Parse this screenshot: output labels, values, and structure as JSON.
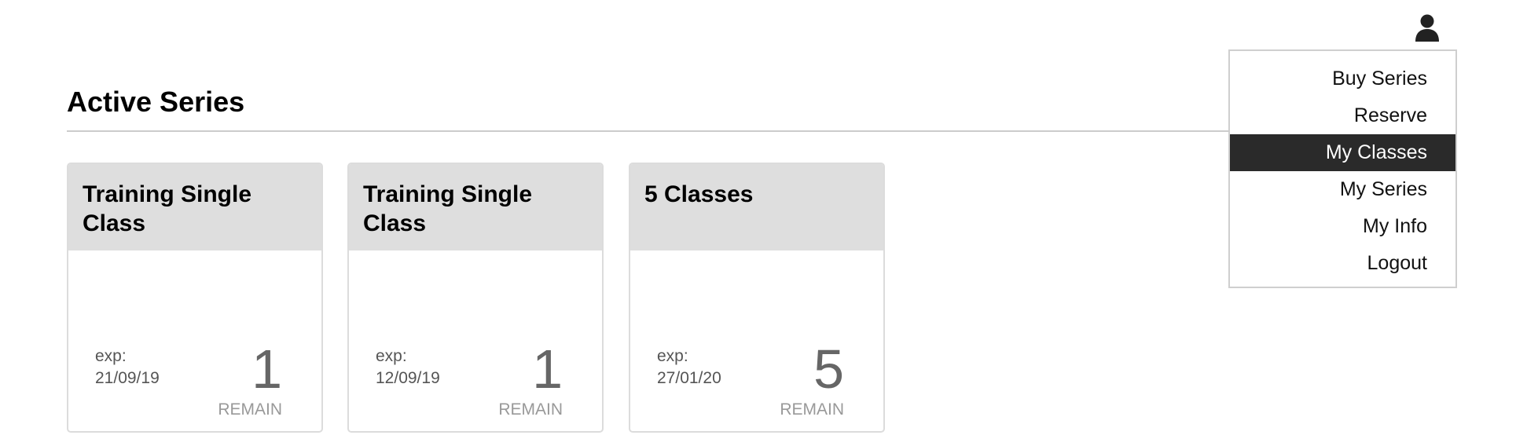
{
  "header": {
    "user_icon": "user-icon"
  },
  "menu": {
    "items": [
      {
        "label": "Buy Series",
        "active": false
      },
      {
        "label": "Reserve",
        "active": false
      },
      {
        "label": "My Classes",
        "active": true
      },
      {
        "label": "My Series",
        "active": false
      },
      {
        "label": "My Info",
        "active": false
      },
      {
        "label": "Logout",
        "active": false
      }
    ]
  },
  "main": {
    "title": "Active Series",
    "cards": [
      {
        "title": "Training Single Class",
        "exp_label": "exp:",
        "exp_date": "21/09/19",
        "count": "1",
        "remain_label": "REMAIN"
      },
      {
        "title": "Training Single Class",
        "exp_label": "exp:",
        "exp_date": "12/09/19",
        "count": "1",
        "remain_label": "REMAIN"
      },
      {
        "title": "5 Classes",
        "exp_label": "exp:",
        "exp_date": "27/01/20",
        "count": "5",
        "remain_label": "REMAIN"
      }
    ]
  },
  "colors": {
    "active_menu_bg": "#2a2a2a",
    "card_header_bg": "#dedede"
  }
}
